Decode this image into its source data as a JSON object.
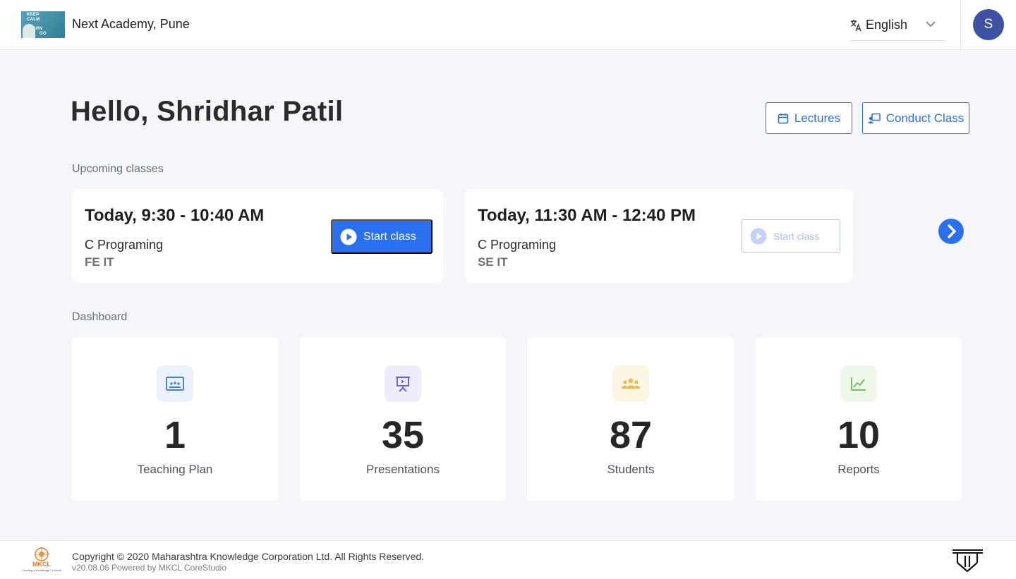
{
  "header": {
    "org_name": "Next Academy, Pune",
    "logo_lines": [
      "KEEP",
      "CALM",
      "and",
      "LEARN",
      "GO"
    ],
    "language": "English",
    "avatar_initial": "S"
  },
  "greeting": "Hello, Shridhar Patil",
  "actions": {
    "lectures_label": "Lectures",
    "conduct_label": "Conduct Class"
  },
  "upcoming": {
    "title": "Upcoming classes",
    "classes": [
      {
        "time": "Today, 9:30 - 10:40 AM",
        "subject": "C Programing",
        "group": "FE IT",
        "button": "Start class",
        "enabled": true
      },
      {
        "time": "Today, 11:30 AM - 12:40 PM",
        "subject": "C Programing",
        "group": "SE IT",
        "button": "Start class",
        "enabled": false
      }
    ]
  },
  "dashboard": {
    "title": "Dashboard",
    "tiles": [
      {
        "value": "1",
        "label": "Teaching Plan",
        "icon": "teaching-plan-icon",
        "color": "#4a7fd1",
        "bg": "#e8f1fc"
      },
      {
        "value": "35",
        "label": "Presentations",
        "icon": "presentation-icon",
        "color": "#6a64d6",
        "bg": "#eeedfb"
      },
      {
        "value": "87",
        "label": "Students",
        "icon": "students-icon",
        "color": "#e6b94a",
        "bg": "#fdf5e4"
      },
      {
        "value": "10",
        "label": "Reports",
        "icon": "reports-icon",
        "color": "#7dbb6a",
        "bg": "#eef7ea"
      }
    ]
  },
  "footer": {
    "brand": "MKCL",
    "brand_tagline": "Creating a Knowledge Lit World",
    "copyright": "Copyright © 2020 Maharashtra Knowledge Corporation Ltd. All Rights Reserved.",
    "version": "v20.08.06 Powered by MKCL CoreStudio"
  },
  "colors": {
    "accent": "#2a6fef",
    "avatar": "#3f51a5"
  }
}
